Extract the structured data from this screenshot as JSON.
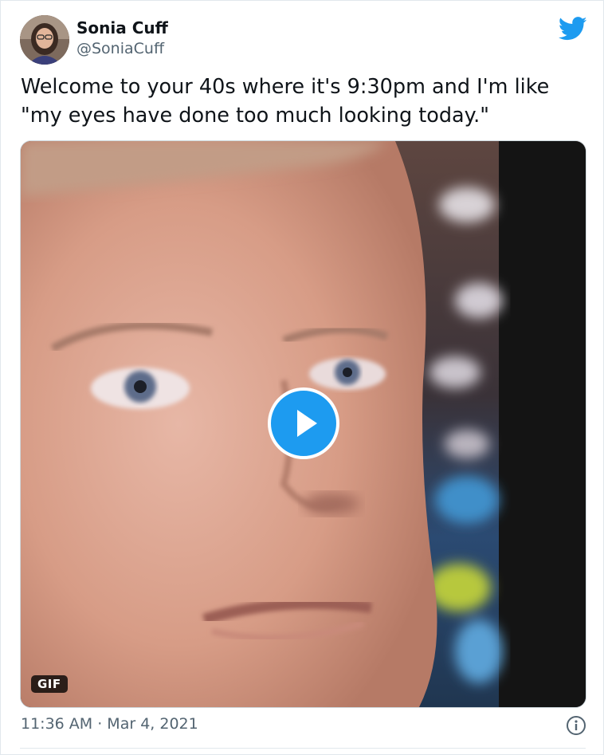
{
  "author": {
    "name": "Sonia Cuff",
    "handle": "@SoniaCuff",
    "avatar_icon": "profile-photo"
  },
  "brand_icon": "twitter-bird-icon",
  "brand_color": "#1d9bf0",
  "tweet": {
    "lines": [
      "Welcome to your 40s where it's 9:30pm and I'm like",
      "\"my eyes have done too much looking today.\""
    ]
  },
  "media": {
    "badge": "GIF",
    "play_icon": "play-icon"
  },
  "meta": {
    "timestamp": "11:36 AM · Mar 4, 2021",
    "info_icon": "info-icon"
  }
}
